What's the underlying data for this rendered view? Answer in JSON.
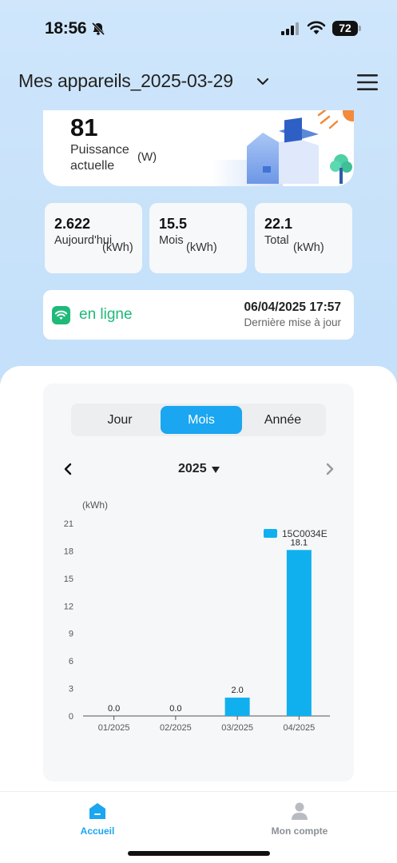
{
  "status_bar": {
    "time": "18:56",
    "battery": "72"
  },
  "header": {
    "title": "Mes appareils_2025-03-29"
  },
  "power": {
    "value": "81",
    "label": "Puissance actuelle",
    "unit": "(W)"
  },
  "stats": [
    {
      "value": "2.622",
      "label": "Aujourd'hui",
      "unit": "(kWh)"
    },
    {
      "value": "15.5",
      "label": "Mois",
      "unit": "(kWh)"
    },
    {
      "value": "22.1",
      "label": "Total",
      "unit": "(kWh)"
    }
  ],
  "connection": {
    "status": "en ligne",
    "updated_at": "06/04/2025 17:57",
    "updated_label": "Dernière mise à jour",
    "status_color": "#1fb978"
  },
  "tabs": [
    {
      "label": "Jour",
      "active": false
    },
    {
      "label": "Mois",
      "active": true
    },
    {
      "label": "Année",
      "active": false
    }
  ],
  "period": {
    "year": "2025"
  },
  "chart_data": {
    "type": "bar",
    "categories": [
      "01/2025",
      "02/2025",
      "03/2025",
      "04/2025"
    ],
    "series": [
      {
        "name": "15C0034E",
        "values": [
          0.0,
          0.0,
          2.0,
          18.1
        ],
        "color": "#10b0ee"
      }
    ],
    "data_labels": [
      "0.0",
      "0.0",
      "2.0",
      "18.1"
    ],
    "ylabel": "(kWh)",
    "yticks": [
      0,
      3,
      6,
      9,
      12,
      15,
      18,
      21
    ],
    "ylim": [
      0,
      21
    ],
    "legend": "top-right",
    "grid": false
  },
  "nav": [
    {
      "label": "Accueil",
      "icon": "home-icon",
      "active": true
    },
    {
      "label": "Mon compte",
      "icon": "user-icon",
      "active": false
    }
  ],
  "colors": {
    "accent": "#1aa6f0",
    "inactive_nav": "#9aa0a6"
  }
}
